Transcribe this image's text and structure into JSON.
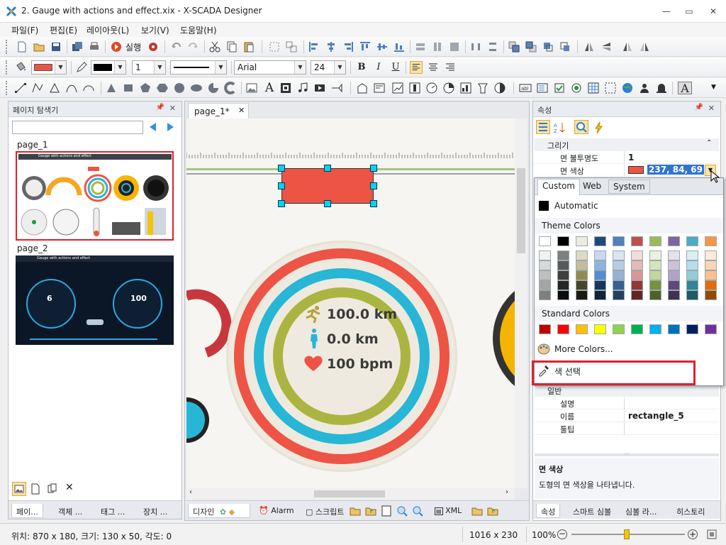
{
  "window": {
    "title": "2. Gauge with actions and effect.xix - X-SCADA Designer",
    "min_glyph": "—",
    "max_glyph": "▭",
    "close_glyph": "✕"
  },
  "menu": [
    "파일(F)",
    "편집(E)",
    "레이아웃(L)",
    "보기(V)",
    "도움말(H)"
  ],
  "toolbar": {
    "run_label": "실행",
    "line_width": "1",
    "font_family": "Arial",
    "font_size": "24",
    "bold": "B",
    "italic": "I",
    "underline": "U",
    "text_glyph": "A"
  },
  "page_explorer": {
    "title": "페이지 탐색기",
    "search_value": "",
    "pages": [
      {
        "name": "page_1",
        "thumb_title": "Gauge with actions and effect"
      },
      {
        "name": "page_2",
        "thumb_title": "Gauge with actions and effect",
        "values": [
          "6",
          "100"
        ]
      }
    ],
    "bottom_tabs": [
      "페이...",
      "객체 ...",
      "태그 ...",
      "장치 ..."
    ]
  },
  "canvas": {
    "tab_label": "page_1*",
    "stats": [
      {
        "text": "100.0 km",
        "icon": "running-person-icon"
      },
      {
        "text": "0.0 km",
        "icon": "walking-person-icon"
      },
      {
        "text": "100 bpm",
        "icon": "heart-icon"
      }
    ],
    "bottom_tabs": [
      "디자인",
      "Alarm",
      "스크립트",
      "XML"
    ]
  },
  "properties": {
    "title": "속성",
    "section_draw": "그리기",
    "section_general": "일반",
    "rows": [
      {
        "name": "면 불투명도",
        "value": "1"
      },
      {
        "name": "면 색상",
        "value": "237, 84, 69"
      }
    ],
    "general_rows": [
      {
        "name": "설명",
        "value": ""
      },
      {
        "name": "이름",
        "value": "rectangle_5"
      },
      {
        "name": "툴팁",
        "value": ""
      }
    ],
    "desc_title": "면 색상",
    "desc_text": "도형의 면 색상을 나타냅니다.",
    "bottom_tabs": [
      "속성",
      "스마트 심볼",
      "심볼 라...",
      "히스토리"
    ]
  },
  "color_picker": {
    "tabs": [
      "Custom",
      "Web",
      "System"
    ],
    "automatic": "Automatic",
    "theme_label": "Theme Colors",
    "standard_label": "Standard Colors",
    "more_colors": "More Colors...",
    "pick_color": "색 선택",
    "theme_top": [
      "#ffffff",
      "#000000",
      "#eeece1",
      "#1f497d",
      "#4f81bd",
      "#c0504d",
      "#9bbb59",
      "#8064a2",
      "#4bacc6",
      "#f79646"
    ],
    "theme_shades": [
      [
        "#f2f2f2",
        "#d8d8d8",
        "#bfbfbf",
        "#a5a5a5",
        "#7f7f7f"
      ],
      [
        "#7f7f7f",
        "#595959",
        "#3f3f3f",
        "#262626",
        "#0c0c0c"
      ],
      [
        "#ddd9c3",
        "#c4bd97",
        "#938953",
        "#494429",
        "#1d1b10"
      ],
      [
        "#c6d9f0",
        "#8db3e2",
        "#548dd4",
        "#17365d",
        "#0f243e"
      ],
      [
        "#dbe5f1",
        "#b8cce4",
        "#95b3d7",
        "#366092",
        "#244061"
      ],
      [
        "#f2dcdb",
        "#e5b9b7",
        "#d99694",
        "#953734",
        "#632423"
      ],
      [
        "#ebf1dd",
        "#d7e3bc",
        "#c3d69b",
        "#76923c",
        "#4f6128"
      ],
      [
        "#e5e0ec",
        "#ccc1d9",
        "#b2a2c7",
        "#5f497a",
        "#3f3151"
      ],
      [
        "#dbeef3",
        "#b7dde8",
        "#92cddc",
        "#31859b",
        "#205867"
      ],
      [
        "#fdeada",
        "#fbd5b5",
        "#fac08f",
        "#e36c09",
        "#974806"
      ]
    ],
    "standard": [
      "#c00000",
      "#ff0000",
      "#ffc000",
      "#ffff00",
      "#92d050",
      "#00b050",
      "#00b0f0",
      "#0070c0",
      "#002060",
      "#7030a0"
    ]
  },
  "status": {
    "position": "위치: 870 x 180, 크기: 130 x 50, 각도: 0",
    "resolution": "1016 x 230",
    "zoom": "100%"
  },
  "colors": {
    "selected_fill": "#ed5445",
    "ring_red": "#ed5445",
    "ring_blue": "#27b6d6",
    "ring_olive": "#aab541",
    "ring_bg": "#eeeadf",
    "highlight": "#e0202e"
  }
}
